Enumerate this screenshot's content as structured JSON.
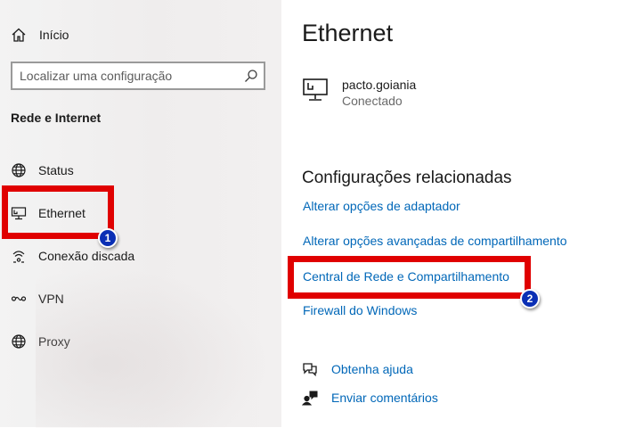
{
  "sidebar": {
    "home_label": "Início",
    "search_placeholder": "Localizar uma configuração",
    "section_title": "Rede e Internet",
    "items": [
      {
        "label": "Status",
        "icon": "globe-icon"
      },
      {
        "label": "Ethernet",
        "icon": "ethernet-icon"
      },
      {
        "label": "Conexão discada",
        "icon": "dialup-icon"
      },
      {
        "label": "VPN",
        "icon": "vpn-icon"
      },
      {
        "label": "Proxy",
        "icon": "globe-icon"
      }
    ]
  },
  "main": {
    "title": "Ethernet",
    "network": {
      "name": "pacto.goiania",
      "status": "Conectado"
    },
    "related_title": "Configurações relacionadas",
    "links": [
      "Alterar opções de adaptador",
      "Alterar opções avançadas de compartilhamento",
      "Central de Rede e Compartilhamento",
      "Firewall do Windows"
    ],
    "help": [
      {
        "label": "Obtenha ajuda",
        "icon": "help-chat-icon"
      },
      {
        "label": "Enviar comentários",
        "icon": "feedback-icon"
      }
    ]
  },
  "annotations": {
    "badge_1": "1",
    "badge_2": "2",
    "highlight_color": "#e00000",
    "badge_color": "#0a2fb5"
  },
  "colors": {
    "link": "#0067b8",
    "sidebar_bg": "#f2f2f2"
  }
}
